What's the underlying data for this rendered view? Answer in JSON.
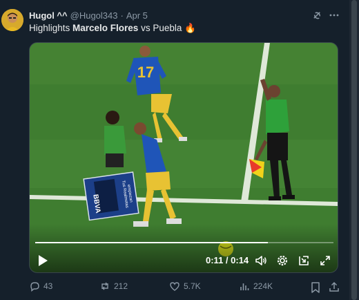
{
  "author": {
    "display_name": "Hugol ^^",
    "handle": "@Hugol343",
    "separator": "·",
    "date": "Apr 5"
  },
  "text": {
    "prefix": "Highlights ",
    "bold": "Marcelo Flores",
    "suffix": " vs Puebla ",
    "emoji": "🔥"
  },
  "video": {
    "time": "0:11 / 0:14",
    "progress": 0.78,
    "scene_text": {
      "jersey_number": "17",
      "board_brand": "BBVA",
      "board_line1": "Tus Realmetas",
      "board_line2": "empiezan"
    }
  },
  "actions": {
    "replies": "43",
    "reposts": "212",
    "likes": "5.7K",
    "views": "224K"
  },
  "colors": {
    "background": "#15202b",
    "text": "#e7e9ea",
    "muted": "#8b98a5",
    "pitch": "#3d7a2e"
  }
}
